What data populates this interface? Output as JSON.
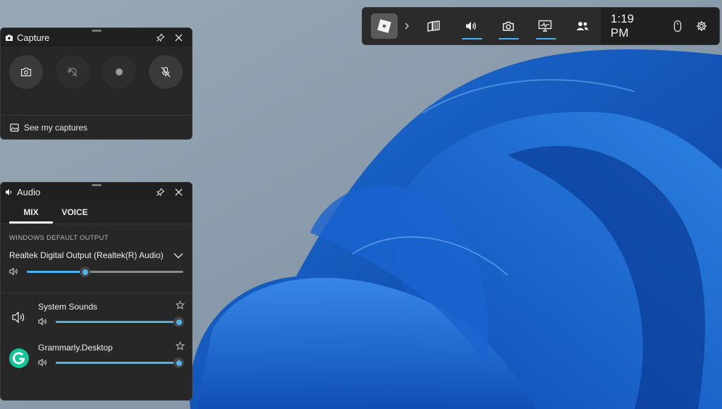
{
  "gamebar": {
    "app_icon": "roblox-logo-icon",
    "widgets": [
      {
        "name": "widget-menu",
        "icon": "widget-store-icon",
        "active": false
      },
      {
        "name": "audio",
        "icon": "speaker-icon",
        "active": true
      },
      {
        "name": "capture",
        "icon": "camera-icon",
        "active": true
      },
      {
        "name": "performance",
        "icon": "monitor-icon",
        "active": true
      },
      {
        "name": "social",
        "icon": "people-icon",
        "active": false
      }
    ],
    "time": "1:19 PM",
    "accent": "#4fb3f0"
  },
  "capture": {
    "title": "Capture",
    "buttons": [
      "screenshot-icon",
      "record-last-30s-icon",
      "record-dot-icon",
      "mic-off-icon"
    ],
    "footer": "See my captures"
  },
  "audio": {
    "title": "Audio",
    "tabs": [
      {
        "label": "MIX",
        "active": true
      },
      {
        "label": "VOICE",
        "active": false
      }
    ],
    "section_label": "WINDOWS DEFAULT OUTPUT",
    "device": "Realtek Digital Output (Realtek(R) Audio)",
    "master_volume": 0.37,
    "apps": [
      {
        "name": "System Sounds",
        "icon": "speaker-icon",
        "volume": 1.0
      },
      {
        "name": "Grammarly.Desktop",
        "icon": "grammarly-logo-icon",
        "volume": 1.0
      }
    ]
  }
}
